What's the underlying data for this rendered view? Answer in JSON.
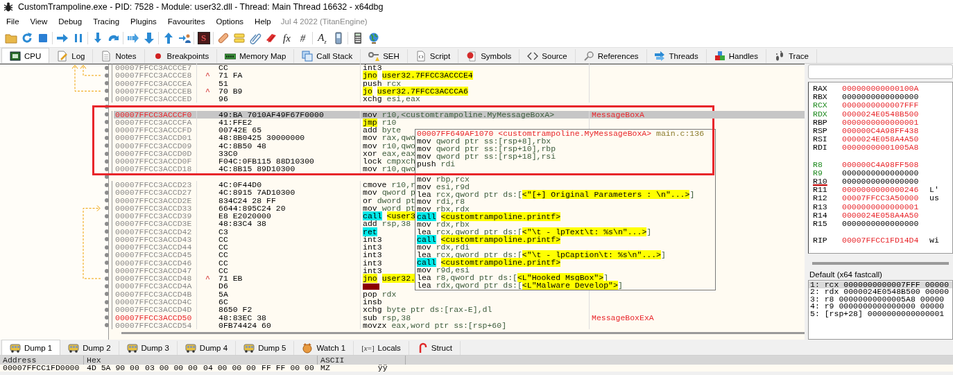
{
  "window": {
    "title": "CustomTrampoline.exe - PID: 7528 - Module: user32.dll - Thread: Main Thread 16632 - x64dbg"
  },
  "menu": {
    "items": [
      "File",
      "View",
      "Debug",
      "Tracing",
      "Plugins",
      "Favourites",
      "Options",
      "Help"
    ],
    "build_info": "Jul 4 2022 (TitanEngine)"
  },
  "toolbar": [
    {
      "kind": "icon"
    },
    {
      "kind": "icon"
    },
    {
      "kind": "icon"
    },
    {
      "kind": "separator"
    },
    {
      "kind": "icon"
    },
    {
      "kind": "icon"
    },
    {
      "kind": "separator"
    },
    {
      "kind": "icon"
    },
    {
      "kind": "icon"
    },
    {
      "kind": "separator"
    },
    {
      "kind": "icon"
    },
    {
      "kind": "icon"
    },
    {
      "kind": "separator"
    },
    {
      "kind": "icon"
    },
    {
      "kind": "icon"
    },
    {
      "kind": "separator"
    },
    {
      "kind": "badge",
      "text": "S"
    },
    {
      "kind": "separator"
    },
    {
      "kind": "icon"
    },
    {
      "kind": "icon"
    },
    {
      "kind": "icon"
    },
    {
      "kind": "icon"
    },
    {
      "kind": "glyph",
      "text": "fx"
    },
    {
      "kind": "glyph",
      "text": "#"
    },
    {
      "kind": "separator"
    },
    {
      "kind": "glyph",
      "text": "A$_{z}$"
    },
    {
      "kind": "icon"
    },
    {
      "kind": "separator"
    },
    {
      "kind": "icon"
    },
    {
      "kind": "icon"
    }
  ],
  "tabs": [
    {
      "label": "CPU",
      "selected": true
    },
    {
      "label": "Log",
      "selected": false
    },
    {
      "label": "Notes",
      "selected": false
    },
    {
      "label": "Breakpoints",
      "selected": false
    },
    {
      "label": "Memory Map",
      "selected": false
    },
    {
      "label": "Call Stack",
      "selected": false
    },
    {
      "label": "SEH",
      "selected": false
    },
    {
      "label": "Script",
      "selected": false
    },
    {
      "label": "Symbols",
      "selected": false
    },
    {
      "label": "Source",
      "selected": false
    },
    {
      "label": "References",
      "selected": false
    },
    {
      "label": "Threads",
      "selected": false
    },
    {
      "label": "Handles",
      "selected": false
    },
    {
      "label": "Trace",
      "selected": false
    }
  ],
  "disasm": {
    "rows": [
      {
        "kind": "plain",
        "address": "00007FFCC3ACCCE7",
        "marked": false,
        "selected": false,
        "bytes": "CC",
        "mnemonic": "int3"
      },
      {
        "kind": "jump",
        "address": "00007FFCC3ACCCE8",
        "marked": false,
        "selected": false,
        "jump_mark": "^",
        "bytes": "71 FA",
        "mnemonic": "jno",
        "symbol": "user32.7FFCC3ACCCE4"
      },
      {
        "kind": "plain",
        "address": "00007FFCC3ACCCEA",
        "marked": false,
        "selected": false,
        "bytes": "51",
        "mnemonic": "push",
        "operands": "rcx"
      },
      {
        "kind": "jump",
        "address": "00007FFCC3ACCCEB",
        "marked": false,
        "selected": false,
        "jump_mark": "^",
        "bytes": "70 B9",
        "mnemonic": "jo",
        "symbol": "user32.7FFCC3ACCCA6"
      },
      {
        "kind": "plain",
        "address": "00007FFCC3ACCCED",
        "marked": false,
        "selected": false,
        "bytes": "96",
        "mnemonic": "xchg",
        "operands": "esi,eax"
      },
      {
        "kind": "obscured"
      },
      {
        "kind": "plain",
        "address": "00007FFCC3ACCCF0",
        "marked": true,
        "selected": true,
        "bytes": "49:BA 7010AF49F67F0000",
        "mnemonic": "mov",
        "operands": "r10,<customtrampoline.MyMessageBoxA>",
        "comment": "MessageBoxA"
      },
      {
        "kind": "jump",
        "address": "00007FFCC3ACCCFA",
        "marked": false,
        "selected": false,
        "bytes": "41:FFE2",
        "mnemonic": "jmp",
        "operands": "r10"
      },
      {
        "kind": "plain",
        "address": "00007FFCC3ACCCFD",
        "marked": false,
        "selected": false,
        "bytes": "00742E 65",
        "mnemonic": "add",
        "operands": "byte"
      },
      {
        "kind": "plain",
        "address": "00007FFCC3ACCD01",
        "marked": false,
        "selected": false,
        "bytes": "48:8B0425 30000000",
        "mnemonic": "mov",
        "operands": "rax,qwo"
      },
      {
        "kind": "plain",
        "address": "00007FFCC3ACCD09",
        "marked": false,
        "selected": false,
        "bytes": "4C:8B50 48",
        "mnemonic": "mov",
        "operands": "r10,qwo"
      },
      {
        "kind": "plain",
        "address": "00007FFCC3ACCD0D",
        "marked": false,
        "selected": false,
        "bytes": "33C0",
        "mnemonic": "xor",
        "operands": "eax,eax"
      },
      {
        "kind": "plain",
        "address": "00007FFCC3ACCD0F",
        "marked": false,
        "selected": false,
        "bytes": "F04C:0FB115 88D10300",
        "mnemonic": "lock",
        "operands": "cmpxch"
      },
      {
        "kind": "plain",
        "address": "00007FFCC3ACCD18",
        "marked": false,
        "selected": false,
        "bytes": "4C:8B15 89D10300",
        "mnemonic": "mov",
        "operands": "r10,qwo"
      },
      {
        "kind": "obscured"
      },
      {
        "kind": "plain",
        "address": "00007FFCC3ACCD23",
        "marked": false,
        "selected": false,
        "bytes": "4C:0F44D0",
        "mnemonic": "cmove",
        "operands": "r10,r"
      },
      {
        "kind": "plain",
        "address": "00007FFCC3ACCD27",
        "marked": false,
        "selected": false,
        "bytes": "4C:8915 7AD10300",
        "mnemonic": "mov",
        "operands": "qword p"
      },
      {
        "kind": "plain",
        "address": "00007FFCC3ACCD2E",
        "marked": false,
        "selected": false,
        "bytes": "834C24 28 FF",
        "mnemonic": "or",
        "operands": "dword pt"
      },
      {
        "kind": "plain",
        "address": "00007FFCC3ACCD33",
        "marked": false,
        "selected": false,
        "bytes": "6644:895C24 20",
        "mnemonic": "mov",
        "operands": "word pt"
      },
      {
        "kind": "call",
        "address": "00007FFCC3ACCD39",
        "marked": false,
        "selected": false,
        "bytes": "E8 E2020000",
        "mnemonic": "call",
        "symbol": "<user3"
      },
      {
        "kind": "plain",
        "address": "00007FFCC3ACCD3E",
        "marked": false,
        "selected": false,
        "bytes": "48:83C4 38",
        "mnemonic": "add",
        "operands": "rsp,38"
      },
      {
        "kind": "ret",
        "address": "00007FFCC3ACCD42",
        "marked": false,
        "selected": false,
        "bytes": "C3",
        "mnemonic": "ret"
      },
      {
        "kind": "plain",
        "address": "00007FFCC3ACCD43",
        "marked": false,
        "selected": false,
        "bytes": "CC",
        "mnemonic": "int3"
      },
      {
        "kind": "plain",
        "address": "00007FFCC3ACCD44",
        "marked": false,
        "selected": false,
        "bytes": "CC",
        "mnemonic": "int3"
      },
      {
        "kind": "plain",
        "address": "00007FFCC3ACCD45",
        "marked": false,
        "selected": false,
        "bytes": "CC",
        "mnemonic": "int3"
      },
      {
        "kind": "plain",
        "address": "00007FFCC3ACCD46",
        "marked": false,
        "selected": false,
        "bytes": "CC",
        "mnemonic": "int3"
      },
      {
        "kind": "plain",
        "address": "00007FFCC3ACCD47",
        "marked": false,
        "selected": false,
        "bytes": "CC",
        "mnemonic": "int3"
      },
      {
        "kind": "jump",
        "address": "00007FFCC3ACCD48",
        "marked": false,
        "selected": false,
        "jump_mark": "^",
        "bytes": "71 EB",
        "mnemonic": "jno",
        "symbol": "user32."
      },
      {
        "kind": "invalid",
        "address": "00007FFCC3ACCD4A",
        "marked": false,
        "selected": false,
        "bytes": "D6"
      },
      {
        "kind": "plain",
        "address": "00007FFCC3ACCD4B",
        "marked": false,
        "selected": false,
        "bytes": "5A",
        "mnemonic": "pop",
        "operands": "rdx"
      },
      {
        "kind": "plain",
        "address": "00007FFCC3ACCD4C",
        "marked": false,
        "selected": false,
        "bytes": "6C",
        "mnemonic": "insb"
      },
      {
        "kind": "plain",
        "address": "00007FFCC3ACCD4D",
        "marked": false,
        "selected": false,
        "bytes": "8650 F2",
        "mnemonic": "xchg",
        "operands": "byte ptr ds:[rax-E],dl"
      },
      {
        "kind": "plain",
        "address": "00007FFCC3ACCD50",
        "marked": true,
        "selected": false,
        "bytes": "48:83EC 38",
        "mnemonic": "sub",
        "operands": "rsp,38",
        "comment": "MessageBoxExA"
      },
      {
        "kind": "plain",
        "address": "00007FFCC3ACCD54",
        "marked": false,
        "selected": false,
        "bytes": "0FB74424 60",
        "mnemonic": "movzx",
        "operands": "eax,word ptr ss:[rsp+60]"
      }
    ],
    "tooltip": {
      "header": {
        "address": "00007FF649AF1070",
        "symbol": "<customtrampoline.MyMessageBoxA>",
        "source": "main.c:136"
      },
      "lines": [
        {
          "kind": "plain",
          "mnemonic": "mov",
          "operands": "qword ptr ss:[rsp+8],rbx"
        },
        {
          "kind": "plain",
          "mnemonic": "mov",
          "operands": "qword ptr ss:[rsp+10],rbp"
        },
        {
          "kind": "plain",
          "mnemonic": "mov",
          "operands": "qword ptr ss:[rsp+18],rsi"
        },
        {
          "kind": "plain",
          "mnemonic": "push",
          "operands": "rdi"
        },
        {
          "kind": "obscured"
        },
        {
          "kind": "plain",
          "mnemonic": "mov",
          "operands": "rbp,rcx"
        },
        {
          "kind": "plain",
          "mnemonic": "mov",
          "operands": "esi,r9d"
        },
        {
          "kind": "plain",
          "mnemonic": "lea",
          "operands": "rcx,qword ptr ds:[",
          "symbol": "<\"[+] Original Parameters : \\n\"...>",
          "suffix": "]"
        },
        {
          "kind": "plain",
          "mnemonic": "mov",
          "operands": "rdi,r8"
        },
        {
          "kind": "plain",
          "mnemonic": "mov",
          "operands": "rbx,rdx"
        },
        {
          "kind": "call",
          "mnemonic": "call",
          "symbol": "<customtrampoline.printf>"
        },
        {
          "kind": "plain",
          "mnemonic": "mov",
          "operands": "rdx,rbx"
        },
        {
          "kind": "plain",
          "mnemonic": "lea",
          "operands": "rcx,qword ptr ds:[",
          "symbol": "<\"\\t - lpText\\t: %s\\n\"...>",
          "suffix": "]"
        },
        {
          "kind": "call",
          "mnemonic": "call",
          "symbol": "<customtrampoline.printf>"
        },
        {
          "kind": "plain",
          "mnemonic": "mov",
          "operands": "rdx,rdi"
        },
        {
          "kind": "plain",
          "mnemonic": "lea",
          "operands": "rcx,qword ptr ds:[",
          "symbol": "<\"\\t - lpCaption\\t: %s\\n\"...>",
          "suffix": "]"
        },
        {
          "kind": "call",
          "mnemonic": "call",
          "symbol": "<customtrampoline.printf>"
        },
        {
          "kind": "plain",
          "mnemonic": "mov",
          "operands": "r9d,esi"
        },
        {
          "kind": "plain",
          "mnemonic": "lea",
          "operands": "r8,qword ptr ds:[",
          "symbol": "<L\"Hooked MsgBox\">",
          "suffix": "]"
        },
        {
          "kind": "plain",
          "mnemonic": "lea",
          "operands": "rdx,qword ptr ds:[",
          "symbol": "<L\"Malware Develop\">",
          "suffix": "]"
        }
      ]
    }
  },
  "registers": {
    "groups": [
      [
        {
          "name": "RAX",
          "value": "000000000000100A",
          "changed": true,
          "argument": false,
          "selected": false
        },
        {
          "name": "RBX",
          "value": "0000000000000000",
          "changed": false,
          "argument": false,
          "selected": false
        },
        {
          "name": "RCX",
          "value": "0000000000007FFF",
          "changed": true,
          "argument": true,
          "selected": false
        },
        {
          "name": "RDX",
          "value": "0000024E0548B500",
          "changed": true,
          "argument": true,
          "selected": false
        },
        {
          "name": "RBP",
          "value": "0000000000000001",
          "changed": true,
          "argument": false,
          "selected": false
        },
        {
          "name": "RSP",
          "value": "000000C4A98FF438",
          "changed": true,
          "argument": false,
          "selected": false
        },
        {
          "name": "RSI",
          "value": "0000024E058A4A50",
          "changed": true,
          "argument": false,
          "selected": false
        },
        {
          "name": "RDI",
          "value": "00000000001005A8",
          "changed": true,
          "argument": false,
          "selected": false
        }
      ],
      [
        {
          "name": "R8",
          "value": "000000C4A98FF508",
          "changed": true,
          "argument": true,
          "selected": false
        },
        {
          "name": "R9",
          "value": "0000000000000000",
          "changed": false,
          "argument": true,
          "selected": false
        },
        {
          "name": "R10",
          "value": "0000000000000000",
          "changed": false,
          "argument": false,
          "selected": true
        },
        {
          "name": "R11",
          "value": "0000000000000246",
          "changed": true,
          "argument": false,
          "selected": false,
          "comment": "L'"
        },
        {
          "name": "R12",
          "value": "00007FFCC3A50000",
          "changed": true,
          "argument": false,
          "selected": false,
          "comment": "us"
        },
        {
          "name": "R13",
          "value": "0000000000000001",
          "changed": true,
          "argument": false,
          "selected": false
        },
        {
          "name": "R14",
          "value": "0000024E058A4A50",
          "changed": true,
          "argument": false,
          "selected": false
        },
        {
          "name": "R15",
          "value": "0000000000000000",
          "changed": false,
          "argument": false,
          "selected": false
        }
      ],
      [
        {
          "name": "RIP",
          "value": "00007FFCC1FD14D4",
          "changed": true,
          "argument": false,
          "selected": false,
          "comment": "wi"
        }
      ]
    ]
  },
  "call_convention": {
    "title": "Default (x64 fastcall)",
    "lines": [
      {
        "text": "1: rcx 0000000000007FFF 00000",
        "selected": true
      },
      {
        "text": "2: rdx 0000024E0548B500 00000",
        "selected": false
      },
      {
        "text": "3: r8 00000000000005A8 00000",
        "selected": false
      },
      {
        "text": "4: r9 0000000000000000 00000",
        "selected": false
      },
      {
        "text": "5: [rsp+28] 0000000000000001",
        "selected": false
      }
    ]
  },
  "dump_tabs": [
    {
      "label": "Dump 1",
      "selected": true
    },
    {
      "label": "Dump 2",
      "selected": false
    },
    {
      "label": "Dump 3",
      "selected": false
    },
    {
      "label": "Dump 4",
      "selected": false
    },
    {
      "label": "Dump 5",
      "selected": false
    },
    {
      "label": "Watch 1",
      "selected": false
    },
    {
      "label": "Locals",
      "selected": false,
      "glyph": "[*x*=]"
    },
    {
      "label": "Struct",
      "selected": false
    }
  ],
  "dump": {
    "columns": [
      "Address",
      "Hex",
      "ASCII"
    ],
    "rows": [
      {
        "address": "00007FFCC1FD0000",
        "hex": [
          "4D 5A 90 00",
          "03 00 00 00",
          "04 00 00 00",
          "FF FF 00 00"
        ],
        "ascii": "MZ          ÿÿ"
      }
    ]
  }
}
